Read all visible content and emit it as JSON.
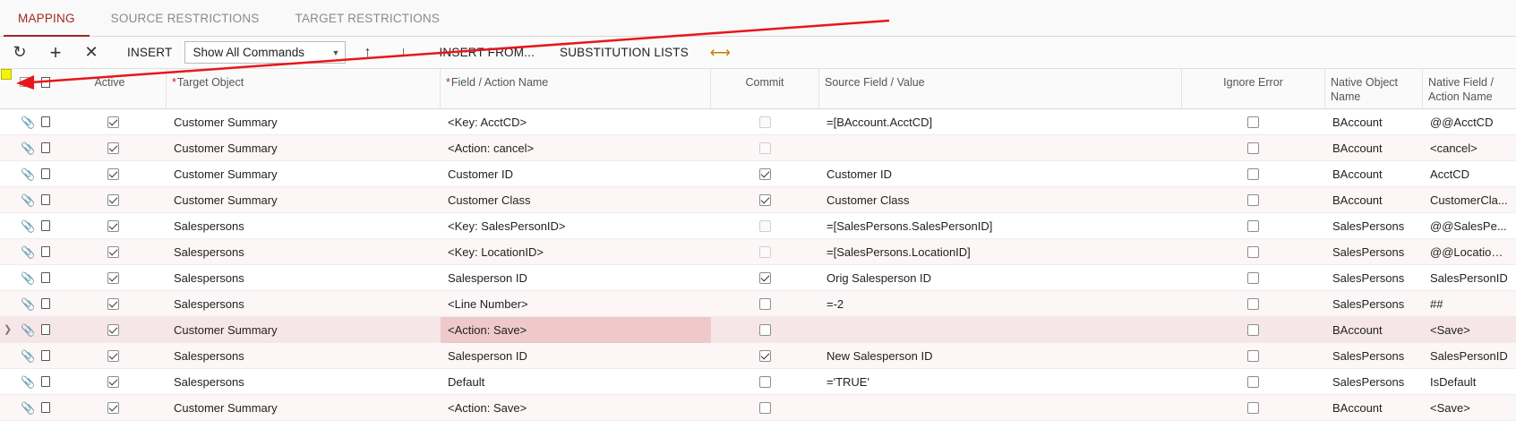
{
  "tabs": [
    {
      "label": "MAPPING",
      "active": true
    },
    {
      "label": "SOURCE RESTRICTIONS",
      "active": false
    },
    {
      "label": "TARGET RESTRICTIONS",
      "active": false
    }
  ],
  "toolbar": {
    "refresh_icon": "refresh-icon",
    "add_icon": "plus-icon",
    "delete_icon": "close-icon",
    "insert_label": "INSERT",
    "commands_select_value": "Show All Commands",
    "move_up_icon": "arrow-up-icon",
    "move_down_icon": "arrow-down-icon",
    "insert_from_label": "INSERT FROM...",
    "substitution_label": "SUBSTITUTION LISTS",
    "fit_icon": "fit-columns-icon"
  },
  "columns": {
    "active": "Active",
    "target_object": "Target Object",
    "field_action": "Field / Action Name",
    "commit": "Commit",
    "source_field": "Source Field / Value",
    "ignore_error": "Ignore Error",
    "native_object": "Native Object Name",
    "native_field": "Native Field / Action Name"
  },
  "rows": [
    {
      "active": true,
      "target": "Customer Summary",
      "field": "<Key: AcctCD>",
      "commit": false,
      "commit_disabled": true,
      "source": "=[BAccount.AcctCD]",
      "ignore": false,
      "native_obj": "BAccount",
      "native_field": "@@AcctCD"
    },
    {
      "active": true,
      "target": "Customer Summary",
      "field": "<Action: cancel>",
      "commit": false,
      "commit_disabled": true,
      "source": "",
      "ignore": false,
      "native_obj": "BAccount",
      "native_field": "<cancel>"
    },
    {
      "active": true,
      "target": "Customer Summary",
      "field": "Customer ID",
      "commit": true,
      "commit_disabled": false,
      "source": "Customer ID",
      "ignore": false,
      "native_obj": "BAccount",
      "native_field": "AcctCD"
    },
    {
      "active": true,
      "target": "Customer Summary",
      "field": "Customer Class",
      "commit": true,
      "commit_disabled": false,
      "source": "Customer Class",
      "ignore": false,
      "native_obj": "BAccount",
      "native_field": "CustomerCla..."
    },
    {
      "active": true,
      "target": "Salespersons",
      "field": "<Key: SalesPersonID>",
      "commit": false,
      "commit_disabled": true,
      "source": "=[SalesPersons.SalesPersonID]",
      "ignore": false,
      "native_obj": "SalesPersons",
      "native_field": "@@SalesPe..."
    },
    {
      "active": true,
      "target": "Salespersons",
      "field": "<Key: LocationID>",
      "commit": false,
      "commit_disabled": true,
      "source": "=[SalesPersons.LocationID]",
      "ignore": false,
      "native_obj": "SalesPersons",
      "native_field": "@@LocationID"
    },
    {
      "active": true,
      "target": "Salespersons",
      "field": "Salesperson ID",
      "commit": true,
      "commit_disabled": false,
      "source": "Orig Salesperson ID",
      "ignore": false,
      "native_obj": "SalesPersons",
      "native_field": "SalesPersonID"
    },
    {
      "active": true,
      "target": "Salespersons",
      "field": "<Line Number>",
      "commit": false,
      "commit_disabled": false,
      "source": "=-2",
      "ignore": false,
      "native_obj": "SalesPersons",
      "native_field": "##"
    },
    {
      "active": true,
      "target": "Customer Summary",
      "field": "<Action: Save>",
      "commit": false,
      "commit_disabled": false,
      "source": "",
      "ignore": false,
      "native_obj": "BAccount",
      "native_field": "<Save>",
      "selected": true
    },
    {
      "active": true,
      "target": "Salespersons",
      "field": "Salesperson ID",
      "commit": true,
      "commit_disabled": false,
      "source": "New Salesperson ID",
      "ignore": false,
      "native_obj": "SalesPersons",
      "native_field": "SalesPersonID"
    },
    {
      "active": true,
      "target": "Salespersons",
      "field": "Default",
      "commit": false,
      "commit_disabled": false,
      "source": "='TRUE'",
      "ignore": false,
      "native_obj": "SalesPersons",
      "native_field": "IsDefault"
    },
    {
      "active": true,
      "target": "Customer Summary",
      "field": "<Action: Save>",
      "commit": false,
      "commit_disabled": false,
      "source": "",
      "ignore": false,
      "native_obj": "BAccount",
      "native_field": "<Save>"
    }
  ],
  "annotation_color": "#e8161b",
  "highlight_color": "#f4f40a"
}
